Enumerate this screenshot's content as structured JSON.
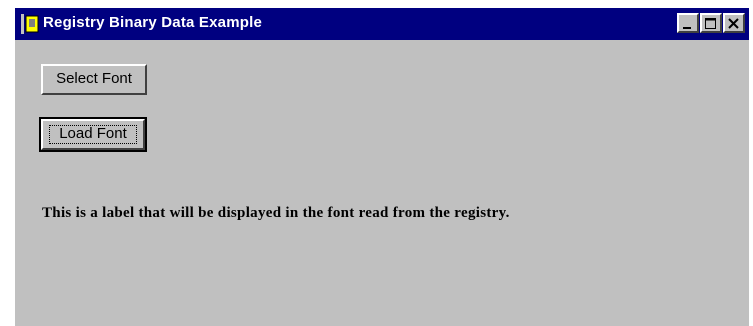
{
  "window": {
    "title": "Registry Binary Data Example",
    "controls": {
      "minimize": "minimize",
      "maximize": "maximize",
      "close": "close"
    }
  },
  "buttons": {
    "select_font_label": "Select Font",
    "load_font_label": "Load Font"
  },
  "label": {
    "text": "This is a label that will be displayed in the font read from the registry."
  },
  "colors": {
    "titlebar": "#000080",
    "background": "#c0c0c0"
  },
  "icons": {
    "app": "app-icon",
    "minimize": "minimize-icon",
    "maximize": "maximize-icon",
    "close": "close-icon"
  }
}
